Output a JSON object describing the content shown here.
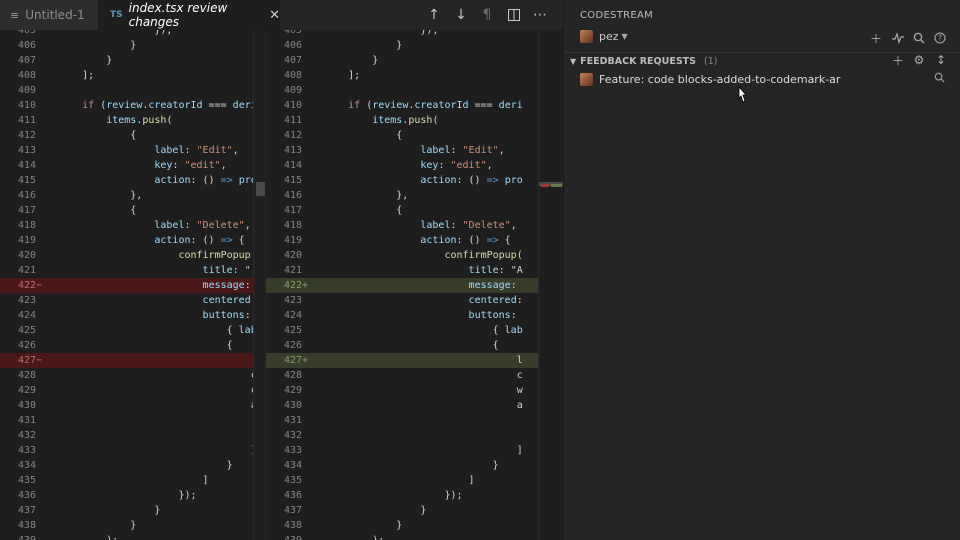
{
  "editor": {
    "tabs": [
      {
        "icon": "menu-lines-icon",
        "label": "Untitled-1"
      },
      {
        "lang": "TS",
        "label": "index.tsx review changes",
        "close": "✕"
      }
    ],
    "toolbar": [
      "arrow-up-icon",
      "arrow-down-icon",
      "pilcrow-icon",
      "split-icon",
      "more-icon"
    ],
    "left_lines": [
      {
        "n": "405",
        "t": "                  });"
      },
      {
        "n": "406",
        "t": "              }"
      },
      {
        "n": "407",
        "t": "          }"
      },
      {
        "n": "408",
        "t": "      ];"
      },
      {
        "n": "409",
        "t": ""
      },
      {
        "n": "410",
        "t": "      if (review.creatorId === deri"
      },
      {
        "n": "411",
        "t": "          items.push("
      },
      {
        "n": "412",
        "t": "              {"
      },
      {
        "n": "413",
        "t": "                  label: \"Edit\","
      },
      {
        "n": "414",
        "t": "                  key: \"edit\","
      },
      {
        "n": "415",
        "t": "                  action: () => pro"
      },
      {
        "n": "416",
        "t": "              },"
      },
      {
        "n": "417",
        "t": "              {"
      },
      {
        "n": "418",
        "t": "                  label: \"Delete\","
      },
      {
        "n": "419",
        "t": "                  action: () => {"
      },
      {
        "n": "420",
        "t": "                      confirmPopup"
      },
      {
        "n": "421",
        "t": "                          title: \""
      },
      {
        "n": "422",
        "t": "                          message:",
        "mark": "−",
        "kind": "del"
      },
      {
        "n": "423",
        "t": "                          centered"
      },
      {
        "n": "424",
        "t": "                          buttons:"
      },
      {
        "n": "425",
        "t": "                              { lab"
      },
      {
        "n": "426",
        "t": "                              {"
      },
      {
        "n": "427",
        "t": "                                  ",
        "mark": "−",
        "kind": "del"
      },
      {
        "n": "428",
        "t": "                                  c"
      },
      {
        "n": "429",
        "t": "                                  c"
      },
      {
        "n": "430",
        "t": "                                  a"
      },
      {
        "n": "431",
        "t": ""
      },
      {
        "n": "432",
        "t": ""
      },
      {
        "n": "433",
        "t": "                                  ]"
      },
      {
        "n": "434",
        "t": "                              }"
      },
      {
        "n": "435",
        "t": "                          ]"
      },
      {
        "n": "436",
        "t": "                      });"
      },
      {
        "n": "437",
        "t": "                  }"
      },
      {
        "n": "438",
        "t": "              }"
      },
      {
        "n": "439",
        "t": "          );"
      }
    ],
    "right_lines": [
      {
        "n": "405",
        "t": "                  });"
      },
      {
        "n": "406",
        "t": "              }"
      },
      {
        "n": "407",
        "t": "          }"
      },
      {
        "n": "408",
        "t": "      ];"
      },
      {
        "n": "409",
        "t": ""
      },
      {
        "n": "410",
        "t": "      if (review.creatorId === deri"
      },
      {
        "n": "411",
        "t": "          items.push("
      },
      {
        "n": "412",
        "t": "              {"
      },
      {
        "n": "413",
        "t": "                  label: \"Edit\","
      },
      {
        "n": "414",
        "t": "                  key: \"edit\","
      },
      {
        "n": "415",
        "t": "                  action: () => pro"
      },
      {
        "n": "416",
        "t": "              },"
      },
      {
        "n": "417",
        "t": "              {"
      },
      {
        "n": "418",
        "t": "                  label: \"Delete\","
      },
      {
        "n": "419",
        "t": "                  action: () => {"
      },
      {
        "n": "420",
        "t": "                      confirmPopup("
      },
      {
        "n": "421",
        "t": "                          title: \"A"
      },
      {
        "n": "422",
        "t": "                          message:",
        "mark": "+",
        "kind": "add"
      },
      {
        "n": "423",
        "t": "                          centered:"
      },
      {
        "n": "424",
        "t": "                          buttons:"
      },
      {
        "n": "425",
        "t": "                              { lab"
      },
      {
        "n": "426",
        "t": "                              {"
      },
      {
        "n": "427",
        "t": "                                  l",
        "mark": "+",
        "kind": "add"
      },
      {
        "n": "428",
        "t": "                                  c"
      },
      {
        "n": "429",
        "t": "                                  w"
      },
      {
        "n": "430",
        "t": "                                  a"
      },
      {
        "n": "431",
        "t": ""
      },
      {
        "n": "432",
        "t": ""
      },
      {
        "n": "433",
        "t": "                                  ]"
      },
      {
        "n": "434",
        "t": "                              }"
      },
      {
        "n": "435",
        "t": "                          ]"
      },
      {
        "n": "436",
        "t": "                      });"
      },
      {
        "n": "437",
        "t": "                  }"
      },
      {
        "n": "438",
        "t": "              }"
      },
      {
        "n": "439",
        "t": "          );"
      }
    ]
  },
  "codestream": {
    "title": "CODESTREAM",
    "user": "pez",
    "header_icons": [
      "plus-icon",
      "activity-icon",
      "search-icon",
      "help-icon"
    ],
    "section": {
      "label": "FEEDBACK REQUESTS",
      "count": "(1)",
      "icons": [
        "plus-icon",
        "gear-icon",
        "vertical-resize-icon"
      ]
    },
    "items": [
      {
        "label": "Feature: code blocks-added-to-codemark-ar"
      }
    ]
  }
}
